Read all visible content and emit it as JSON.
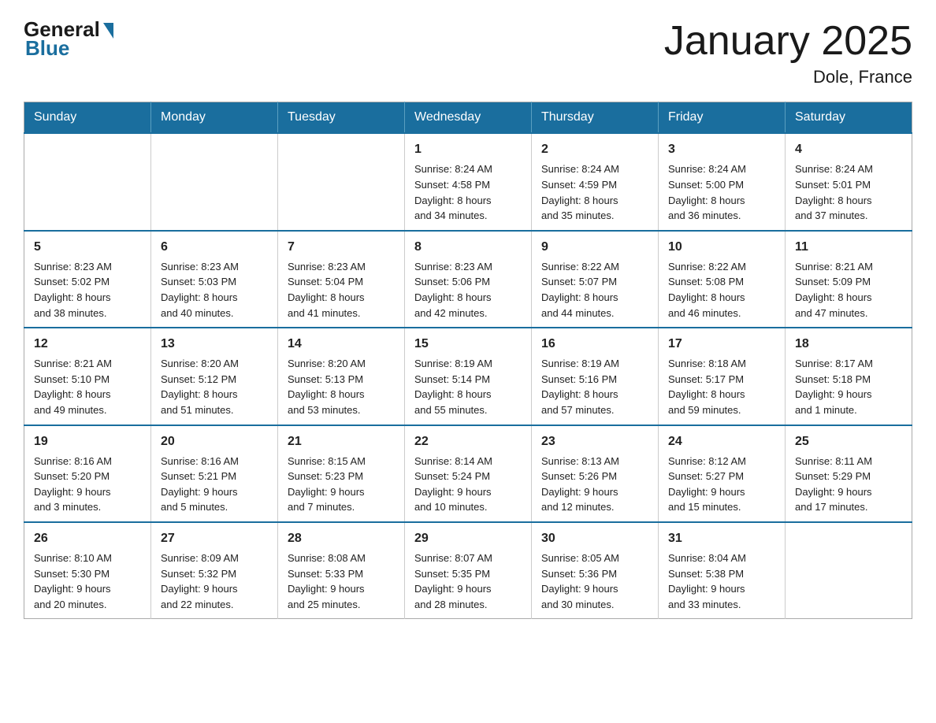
{
  "logo": {
    "general": "General",
    "blue": "Blue"
  },
  "title": "January 2025",
  "subtitle": "Dole, France",
  "days_of_week": [
    "Sunday",
    "Monday",
    "Tuesday",
    "Wednesday",
    "Thursday",
    "Friday",
    "Saturday"
  ],
  "weeks": [
    [
      {
        "day": "",
        "info": ""
      },
      {
        "day": "",
        "info": ""
      },
      {
        "day": "",
        "info": ""
      },
      {
        "day": "1",
        "info": "Sunrise: 8:24 AM\nSunset: 4:58 PM\nDaylight: 8 hours\nand 34 minutes."
      },
      {
        "day": "2",
        "info": "Sunrise: 8:24 AM\nSunset: 4:59 PM\nDaylight: 8 hours\nand 35 minutes."
      },
      {
        "day": "3",
        "info": "Sunrise: 8:24 AM\nSunset: 5:00 PM\nDaylight: 8 hours\nand 36 minutes."
      },
      {
        "day": "4",
        "info": "Sunrise: 8:24 AM\nSunset: 5:01 PM\nDaylight: 8 hours\nand 37 minutes."
      }
    ],
    [
      {
        "day": "5",
        "info": "Sunrise: 8:23 AM\nSunset: 5:02 PM\nDaylight: 8 hours\nand 38 minutes."
      },
      {
        "day": "6",
        "info": "Sunrise: 8:23 AM\nSunset: 5:03 PM\nDaylight: 8 hours\nand 40 minutes."
      },
      {
        "day": "7",
        "info": "Sunrise: 8:23 AM\nSunset: 5:04 PM\nDaylight: 8 hours\nand 41 minutes."
      },
      {
        "day": "8",
        "info": "Sunrise: 8:23 AM\nSunset: 5:06 PM\nDaylight: 8 hours\nand 42 minutes."
      },
      {
        "day": "9",
        "info": "Sunrise: 8:22 AM\nSunset: 5:07 PM\nDaylight: 8 hours\nand 44 minutes."
      },
      {
        "day": "10",
        "info": "Sunrise: 8:22 AM\nSunset: 5:08 PM\nDaylight: 8 hours\nand 46 minutes."
      },
      {
        "day": "11",
        "info": "Sunrise: 8:21 AM\nSunset: 5:09 PM\nDaylight: 8 hours\nand 47 minutes."
      }
    ],
    [
      {
        "day": "12",
        "info": "Sunrise: 8:21 AM\nSunset: 5:10 PM\nDaylight: 8 hours\nand 49 minutes."
      },
      {
        "day": "13",
        "info": "Sunrise: 8:20 AM\nSunset: 5:12 PM\nDaylight: 8 hours\nand 51 minutes."
      },
      {
        "day": "14",
        "info": "Sunrise: 8:20 AM\nSunset: 5:13 PM\nDaylight: 8 hours\nand 53 minutes."
      },
      {
        "day": "15",
        "info": "Sunrise: 8:19 AM\nSunset: 5:14 PM\nDaylight: 8 hours\nand 55 minutes."
      },
      {
        "day": "16",
        "info": "Sunrise: 8:19 AM\nSunset: 5:16 PM\nDaylight: 8 hours\nand 57 minutes."
      },
      {
        "day": "17",
        "info": "Sunrise: 8:18 AM\nSunset: 5:17 PM\nDaylight: 8 hours\nand 59 minutes."
      },
      {
        "day": "18",
        "info": "Sunrise: 8:17 AM\nSunset: 5:18 PM\nDaylight: 9 hours\nand 1 minute."
      }
    ],
    [
      {
        "day": "19",
        "info": "Sunrise: 8:16 AM\nSunset: 5:20 PM\nDaylight: 9 hours\nand 3 minutes."
      },
      {
        "day": "20",
        "info": "Sunrise: 8:16 AM\nSunset: 5:21 PM\nDaylight: 9 hours\nand 5 minutes."
      },
      {
        "day": "21",
        "info": "Sunrise: 8:15 AM\nSunset: 5:23 PM\nDaylight: 9 hours\nand 7 minutes."
      },
      {
        "day": "22",
        "info": "Sunrise: 8:14 AM\nSunset: 5:24 PM\nDaylight: 9 hours\nand 10 minutes."
      },
      {
        "day": "23",
        "info": "Sunrise: 8:13 AM\nSunset: 5:26 PM\nDaylight: 9 hours\nand 12 minutes."
      },
      {
        "day": "24",
        "info": "Sunrise: 8:12 AM\nSunset: 5:27 PM\nDaylight: 9 hours\nand 15 minutes."
      },
      {
        "day": "25",
        "info": "Sunrise: 8:11 AM\nSunset: 5:29 PM\nDaylight: 9 hours\nand 17 minutes."
      }
    ],
    [
      {
        "day": "26",
        "info": "Sunrise: 8:10 AM\nSunset: 5:30 PM\nDaylight: 9 hours\nand 20 minutes."
      },
      {
        "day": "27",
        "info": "Sunrise: 8:09 AM\nSunset: 5:32 PM\nDaylight: 9 hours\nand 22 minutes."
      },
      {
        "day": "28",
        "info": "Sunrise: 8:08 AM\nSunset: 5:33 PM\nDaylight: 9 hours\nand 25 minutes."
      },
      {
        "day": "29",
        "info": "Sunrise: 8:07 AM\nSunset: 5:35 PM\nDaylight: 9 hours\nand 28 minutes."
      },
      {
        "day": "30",
        "info": "Sunrise: 8:05 AM\nSunset: 5:36 PM\nDaylight: 9 hours\nand 30 minutes."
      },
      {
        "day": "31",
        "info": "Sunrise: 8:04 AM\nSunset: 5:38 PM\nDaylight: 9 hours\nand 33 minutes."
      },
      {
        "day": "",
        "info": ""
      }
    ]
  ]
}
